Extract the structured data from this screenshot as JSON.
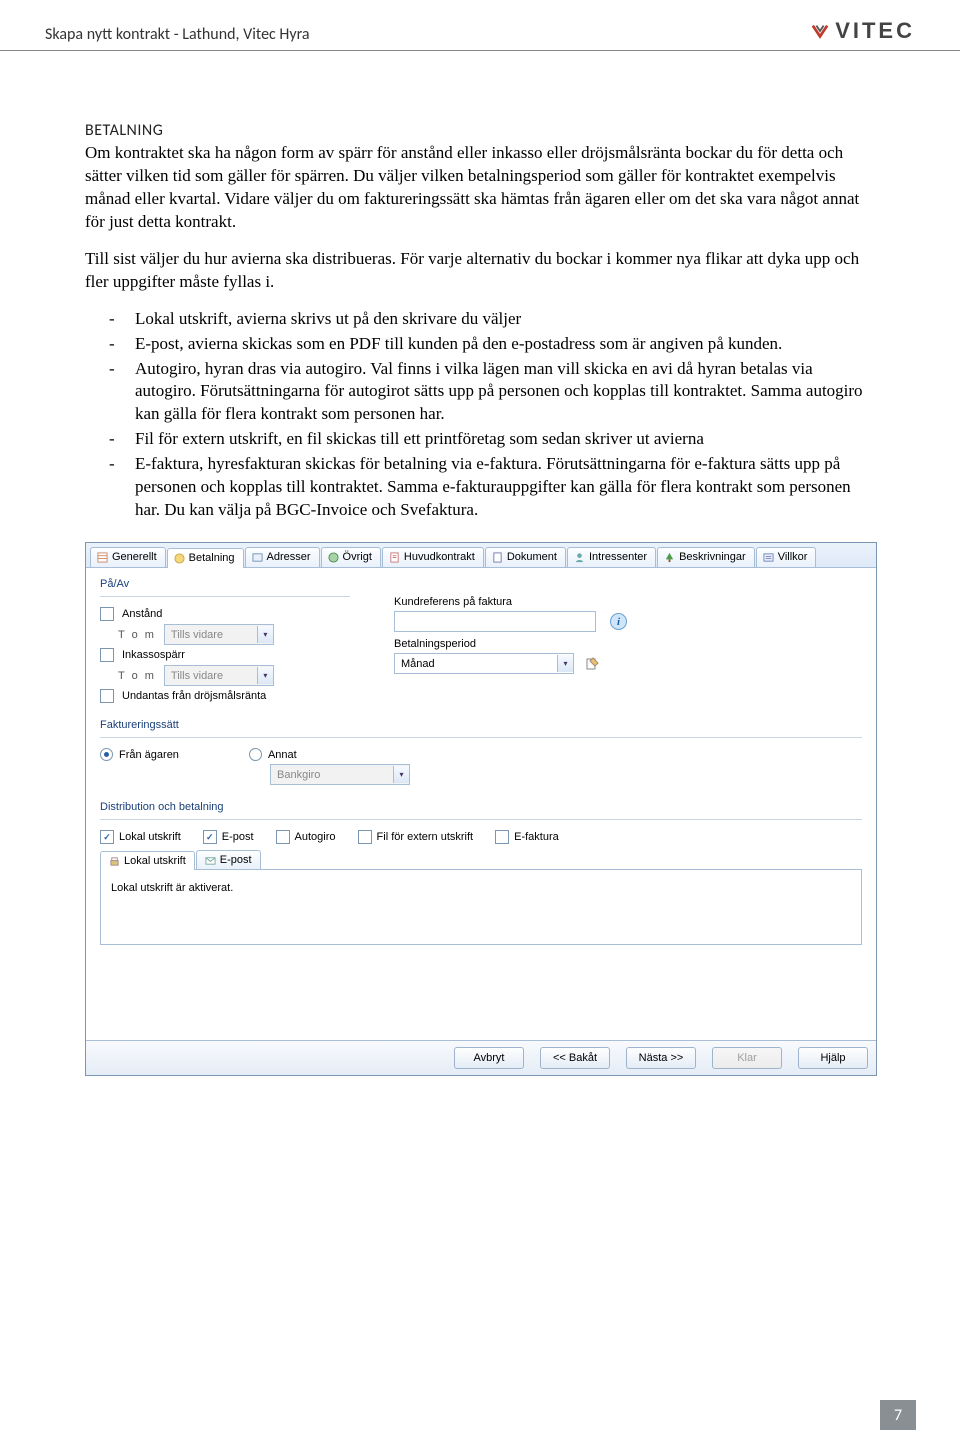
{
  "header": {
    "title": "Skapa nytt kontrakt - Lathund, Vitec Hyra",
    "logo_text": "VITEC"
  },
  "section": {
    "heading": "BETALNING",
    "para1": "Om kontraktet ska ha någon form av spärr för anstånd eller inkasso eller dröjsmålsränta bockar du för detta och sätter vilken tid som gäller för spärren. Du väljer vilken betalningsperiod som gäller för kontraktet exempelvis månad eller kvartal. Vidare väljer du om faktureringssätt ska hämtas från ägaren eller om det ska vara något annat för just detta kontrakt.",
    "para2": "Till sist väljer du hur avierna ska distribueras. För varje alternativ du bockar i kommer nya flikar att dyka upp och fler uppgifter måste fyllas i.",
    "bullets": [
      "Lokal utskrift, avierna skrivs ut på den skrivare du väljer",
      "E-post, avierna skickas som en PDF till kunden på den e-postadress som är angiven på kunden.",
      "Autogiro, hyran dras via autogiro. Val finns i vilka lägen man vill skicka en avi då hyran betalas via autogiro. Förutsättningarna för autogirot sätts upp på personen och kopplas till kontraktet. Samma autogiro kan gälla för flera kontrakt som personen har.",
      "Fil för extern utskrift, en fil skickas till ett printföretag som sedan skriver ut avierna",
      "E-faktura, hyresfakturan skickas för betalning via e-faktura. Förutsättningarna för e-faktura sätts upp på personen och kopplas till kontraktet. Samma e-fakturauppgifter kan gälla för flera kontrakt som personen har. Du kan välja på BGC-Invoice och Svefaktura."
    ]
  },
  "app": {
    "tabs": [
      "Generellt",
      "Betalning",
      "Adresser",
      "Övrigt",
      "Huvudkontrakt",
      "Dokument",
      "Intressenter",
      "Beskrivningar",
      "Villkor"
    ],
    "active_tab": 1,
    "group_pa_av": {
      "title": "På/Av",
      "anstand": "Anstånd",
      "tom": "T o m",
      "tom_value": "Tills vidare",
      "inkasso": "Inkassospärr",
      "undantas": "Undantas från dröjsmålsränta"
    },
    "group_right": {
      "kundref": "Kundreferens på faktura",
      "betalperiod_label": "Betalningsperiod",
      "betalperiod_value": "Månad"
    },
    "group_fakt": {
      "title": "Faktureringssätt",
      "agaren": "Från ägaren",
      "annat": "Annat",
      "bankgiro": "Bankgiro"
    },
    "group_dist": {
      "title": "Distribution och betalning",
      "lokal": "Lokal utskrift",
      "epost": "E-post",
      "autogiro": "Autogiro",
      "extern": "Fil för extern utskrift",
      "efaktura": "E-faktura",
      "sub_lokal": "Lokal utskrift",
      "sub_epost": "E-post",
      "status": "Lokal utskrift är aktiverat."
    },
    "footer": {
      "avbryt": "Avbryt",
      "bakat": "<< Bakåt",
      "nasta": "Nästa >>",
      "klar": "Klar",
      "hjalp": "Hjälp"
    }
  },
  "page_number": "7"
}
